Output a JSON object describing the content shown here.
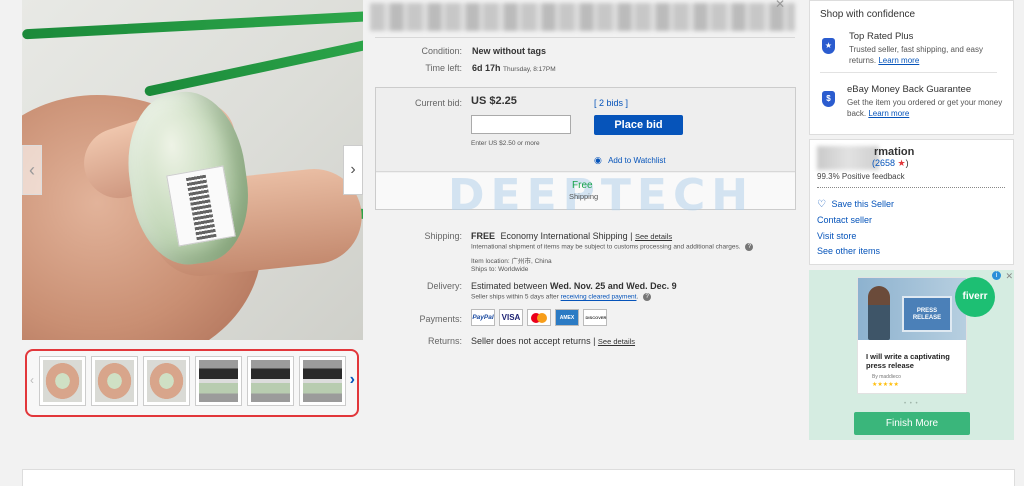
{
  "listing": {
    "condition_label": "Condition:",
    "condition_value": "New without tags",
    "time_left_label": "Time left:",
    "time_left_value": "6d 17h",
    "time_left_detail": "Thursday, 8:17PM"
  },
  "bid": {
    "current_bid_label": "Current bid:",
    "current_bid_value": "US $2.25",
    "bids_link": "[ 2 bids ]",
    "input_value": "",
    "input_hint": "Enter US $2.50 or more",
    "place_bid_label": "Place bid",
    "watchlist_label": "Add to Watchlist",
    "free_label": "Free",
    "shipping_label": "Shipping",
    "watermark": "DEEPTECH"
  },
  "shipping": {
    "label": "Shipping:",
    "free": "FREE",
    "method": "Economy International Shipping",
    "separator": " | ",
    "see_details": "See details",
    "note": "International shipment of items may be subject to customs processing and additional charges.",
    "item_location": "Item location:",
    "location_value": "广州市, China",
    "ships_to": "Ships to:",
    "ships_to_value": "Worldwide"
  },
  "delivery": {
    "label": "Delivery:",
    "estimate_prefix": "Estimated between ",
    "estimate_range": "Wed. Nov. 25 and Wed. Dec. 9",
    "note_prefix": "Seller ships within 5 days after ",
    "note_link": "receiving cleared payment",
    "note_suffix": "."
  },
  "payments": {
    "label": "Payments:",
    "methods": [
      "PayPal",
      "VISA",
      "",
      "AMEX",
      "DISCOVER"
    ]
  },
  "returns": {
    "label": "Returns:",
    "value": "Seller does not accept returns",
    "separator": " | ",
    "see_details": "See details"
  },
  "confidence": {
    "title": "Shop with confidence",
    "items": [
      {
        "title": "Top Rated Plus",
        "desc": "Trusted seller, fast shipping, and easy returns.",
        "link": "Learn more"
      },
      {
        "title": "eBay Money Back Guarantee",
        "desc": "Get the item you ordered or get your money back.",
        "link": "Learn more"
      }
    ]
  },
  "seller": {
    "title_partial": "rmation",
    "feedback_count": "(2658",
    "star": "★",
    "feedback_close": ")",
    "positive": "99.3% Positive feedback",
    "save_label": "Save this Seller",
    "contact_label": "Contact seller",
    "store_label": "Visit store",
    "other_label": "See other items"
  },
  "ad": {
    "board_text": "PRESS RELEASE",
    "brand": "fiverr",
    "headline": "I will write a captivating press release",
    "by": "By maddieco",
    "stars": "★★★★★",
    "dots": "• • •",
    "cta": "Finish More"
  },
  "gallery": {
    "thumb_count": 6
  },
  "colors": {
    "ebay_blue": "#0654ba",
    "highlight_red": "#e2373b",
    "fiverr_green": "#1dbf73"
  }
}
